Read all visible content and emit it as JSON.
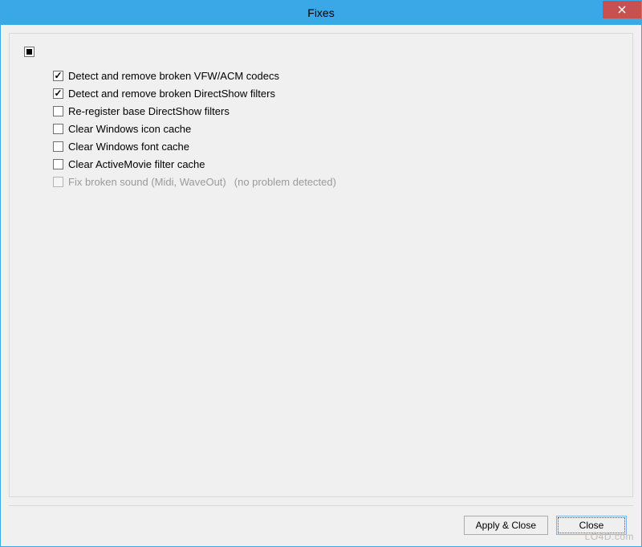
{
  "window": {
    "title": "Fixes"
  },
  "checkboxes": {
    "items": [
      {
        "label": "Detect and remove broken VFW/ACM codecs",
        "checked": true,
        "disabled": false,
        "suffix": ""
      },
      {
        "label": "Detect and remove broken DirectShow filters",
        "checked": true,
        "disabled": false,
        "suffix": ""
      },
      {
        "label": "Re-register base DirectShow filters",
        "checked": false,
        "disabled": false,
        "suffix": ""
      },
      {
        "label": "Clear Windows icon cache",
        "checked": false,
        "disabled": false,
        "suffix": ""
      },
      {
        "label": "Clear Windows font cache",
        "checked": false,
        "disabled": false,
        "suffix": ""
      },
      {
        "label": "Clear ActiveMovie filter cache",
        "checked": false,
        "disabled": false,
        "suffix": ""
      },
      {
        "label": "Fix broken sound (Midi, WaveOut)",
        "checked": false,
        "disabled": true,
        "suffix": "(no problem detected)"
      }
    ]
  },
  "buttons": {
    "apply_close": "Apply & Close",
    "close": "Close"
  },
  "watermark": "LO4D.com"
}
